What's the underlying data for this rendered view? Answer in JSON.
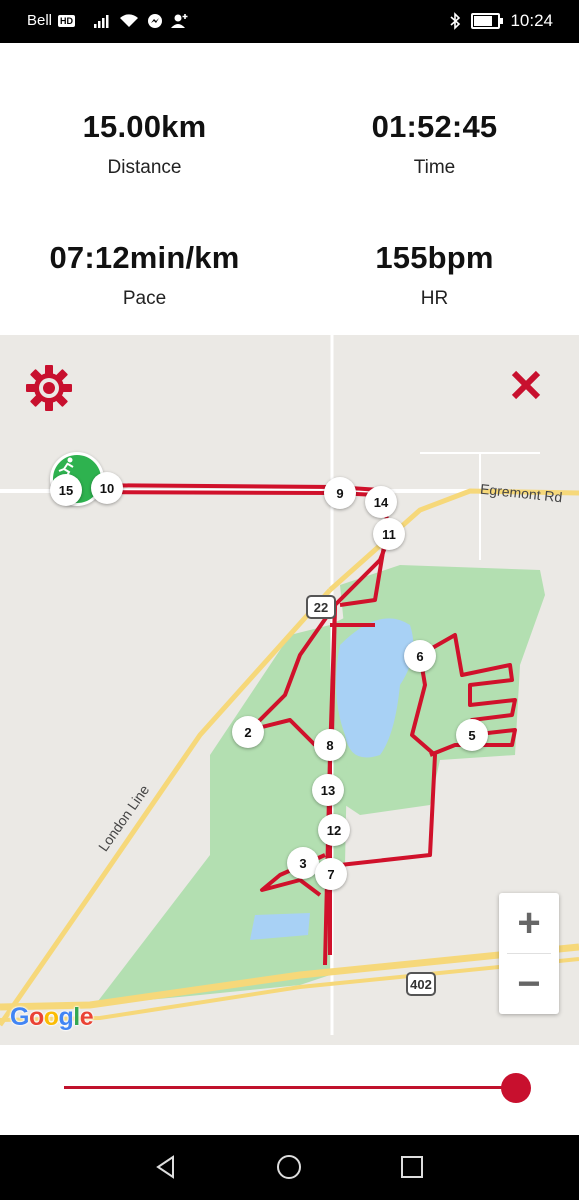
{
  "status_bar": {
    "carrier": "Bell",
    "network_badge": "HD",
    "time": "10:24",
    "battery_level": 0.85,
    "icons": [
      "signal-icon",
      "wifi-icon",
      "messenger-icon",
      "person-add-icon",
      "bluetooth-icon",
      "battery-icon"
    ]
  },
  "stats": {
    "distance": {
      "value": "15.00km",
      "label": "Distance"
    },
    "time": {
      "value": "01:52:45",
      "label": "Time"
    },
    "pace": {
      "value": "07:12min/km",
      "label": "Pace"
    },
    "hr": {
      "value": "155bpm",
      "label": "HR"
    }
  },
  "map": {
    "road_labels": {
      "egremont": "Egremont Rd",
      "london": "London Line"
    },
    "shields": {
      "hwy22": "22",
      "hwy402": "402"
    },
    "zoom_in": "+",
    "zoom_out": "−",
    "google_logo": [
      "G",
      "o",
      "o",
      "g",
      "l",
      "e"
    ],
    "route_color": "#d0112b",
    "markers": [
      "15",
      "10",
      "9",
      "14",
      "11",
      "6",
      "2",
      "8",
      "5",
      "13",
      "12",
      "3",
      "7"
    ]
  },
  "slider": {
    "value": 1.0,
    "accent": "#c8102e"
  },
  "nav": {
    "icons": [
      "back-icon",
      "home-icon",
      "recents-icon"
    ]
  }
}
